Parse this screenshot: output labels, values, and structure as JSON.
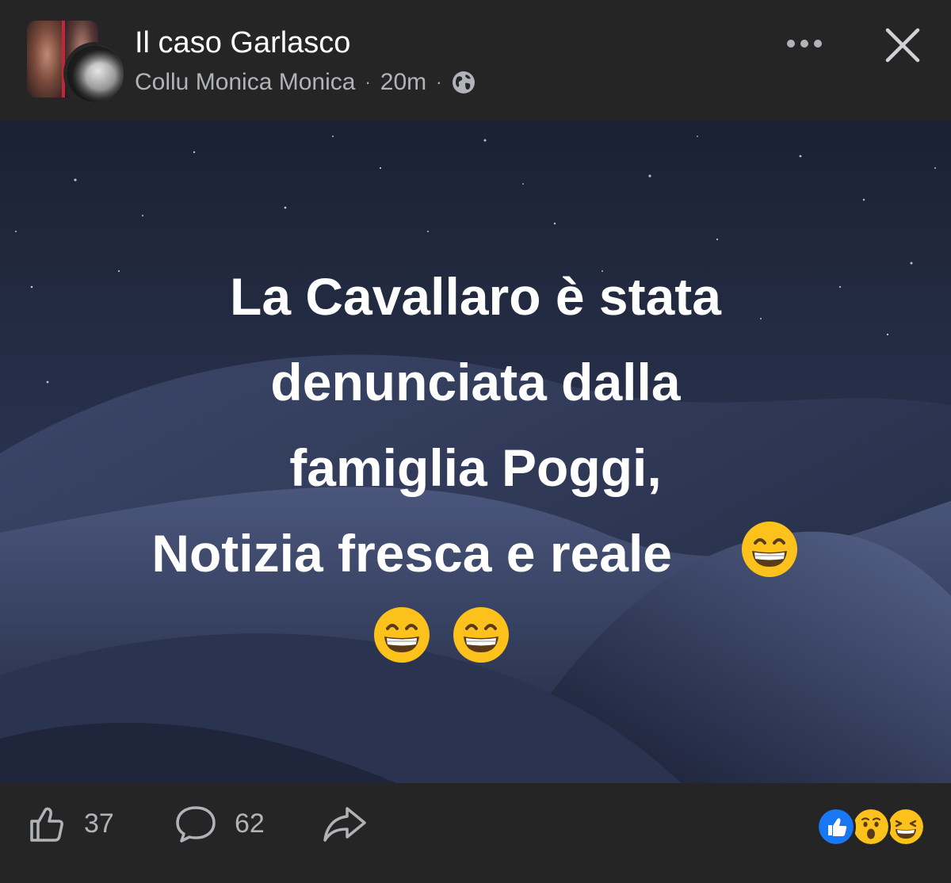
{
  "header": {
    "group_name": "Il caso Garlasco",
    "author": "Collu Monica Monica",
    "separator": "·",
    "time": "20m",
    "privacy_icon": "globe-icon",
    "more_icon": "more-horizontal-icon",
    "close_icon": "close-icon"
  },
  "post": {
    "background": "night-sky-sand-dunes",
    "text_lines": [
      "La Cavallaro è stata",
      "denunciata dalla",
      "famiglia Poggi,",
      "Notizia fresca e reale"
    ],
    "emoji": "grinning-face-with-smiling-eyes",
    "emoji_count": 3
  },
  "footer": {
    "like_count": "37",
    "comment_count": "62",
    "like_icon": "thumbs-up-icon",
    "comment_icon": "comment-bubble-icon",
    "share_icon": "share-arrow-icon",
    "reactions": [
      "like",
      "wow",
      "haha"
    ]
  },
  "colors": {
    "background": "#252526",
    "text_primary": "#ffffff",
    "text_secondary": "#b0b3b8",
    "like_blue": "#1877f2",
    "emoji_yellow": "#fcc21b"
  }
}
